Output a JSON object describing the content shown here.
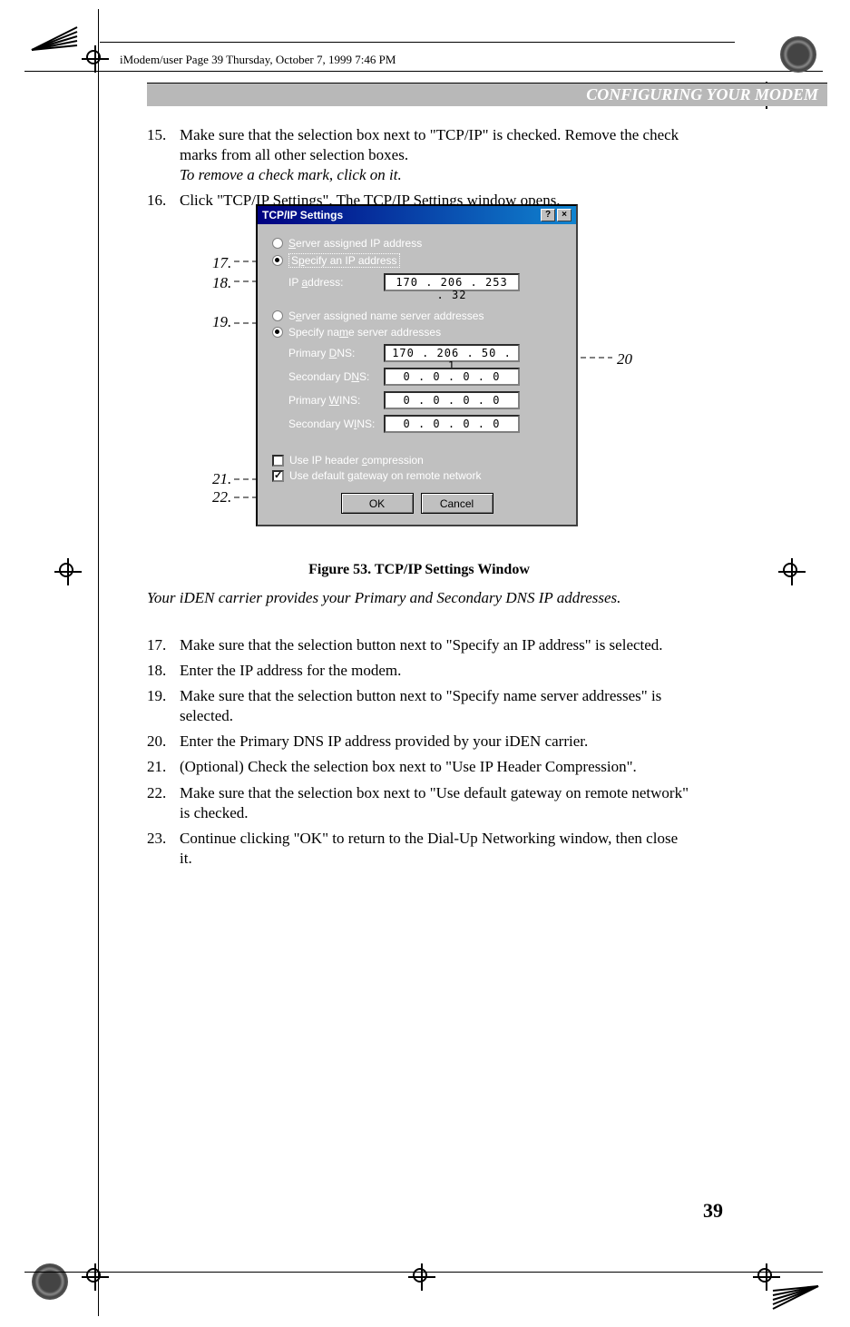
{
  "header": {
    "running": "iModem/user  Page 39  Thursday, October 7, 1999  7:46 PM",
    "banner": "CONFIGURING YOUR MODEM"
  },
  "steps_top": {
    "n15": "15.",
    "t15a": "Make sure that the selection box next to \"TCP/IP\" is checked. Remove the check marks from all other selection boxes.",
    "t15b": "To remove a check mark, click on it.",
    "n16": "16.",
    "t16": "Click \"TCP/IP Settings\". The TCP/IP Settings window opens."
  },
  "callouts": {
    "c17": "17.",
    "c18": "18.",
    "c19": "19.",
    "c20": "20",
    "c21": "21.",
    "c22": "22."
  },
  "dialog": {
    "title": "TCP/IP Settings",
    "help": "?",
    "close": "×",
    "radio1": "Server assigned IP address",
    "radio2": "Specify an IP address",
    "ip_label": "IP address:",
    "ip_value": "170 . 206 . 253 .  32",
    "radio3": "Server assigned name server addresses",
    "radio4": "Specify name server addresses",
    "pdns_label": "Primary DNS:",
    "pdns_value": "170 . 206 .  50  .   1",
    "sdns_label": "Secondary DNS:",
    "sdns_value": "0  .  0  .  0  .  0",
    "pwins_label": "Primary WINS:",
    "pwins_value": "0  .  0  .  0  .  0",
    "swins_label": "Secondary WINS:",
    "swins_value": "0  .  0  .  0  .  0",
    "check1": "Use IP header compression",
    "check2": "Use default gateway on remote network",
    "ok": "OK",
    "cancel": "Cancel"
  },
  "chart_data": {
    "type": "table",
    "title": "TCP/IP Settings",
    "fields": [
      {
        "name": "IP address",
        "value": "170.206.253.32"
      },
      {
        "name": "Primary DNS",
        "value": "170.206.50.1"
      },
      {
        "name": "Secondary DNS",
        "value": "0.0.0.0"
      },
      {
        "name": "Primary WINS",
        "value": "0.0.0.0"
      },
      {
        "name": "Secondary WINS",
        "value": "0.0.0.0"
      }
    ],
    "options": [
      {
        "name": "Server assigned IP address",
        "selected": false
      },
      {
        "name": "Specify an IP address",
        "selected": true
      },
      {
        "name": "Server assigned name server addresses",
        "selected": false
      },
      {
        "name": "Specify name server addresses",
        "selected": true
      },
      {
        "name": "Use IP header compression",
        "checked": false
      },
      {
        "name": "Use default gateway on remote network",
        "checked": true
      }
    ]
  },
  "figure_caption": "Figure 53. TCP/IP Settings Window",
  "note": "Your iDEN carrier provides your Primary and Secondary DNS IP addresses.",
  "steps_bottom": {
    "n17": "17.",
    "t17": "Make sure that the selection button next to \"Specify an IP address\" is selected.",
    "n18": "18.",
    "t18": "Enter the IP address for the modem.",
    "n19": "19.",
    "t19": "Make sure that the selection button next to \"Specify name server addresses\" is selected.",
    "n20": "20.",
    "t20": "Enter the Primary DNS IP address provided by your iDEN carrier.",
    "n21": "21.",
    "t21": "(Optional) Check the selection box next to \"Use IP Header Compression\".",
    "n22": "22.",
    "t22": "Make sure that the selection box next to \"Use default gateway on remote network\" is checked.",
    "n23": "23.",
    "t23": "Continue clicking \"OK\" to return to the Dial-Up Networking window, then close it."
  },
  "page_num": "39"
}
